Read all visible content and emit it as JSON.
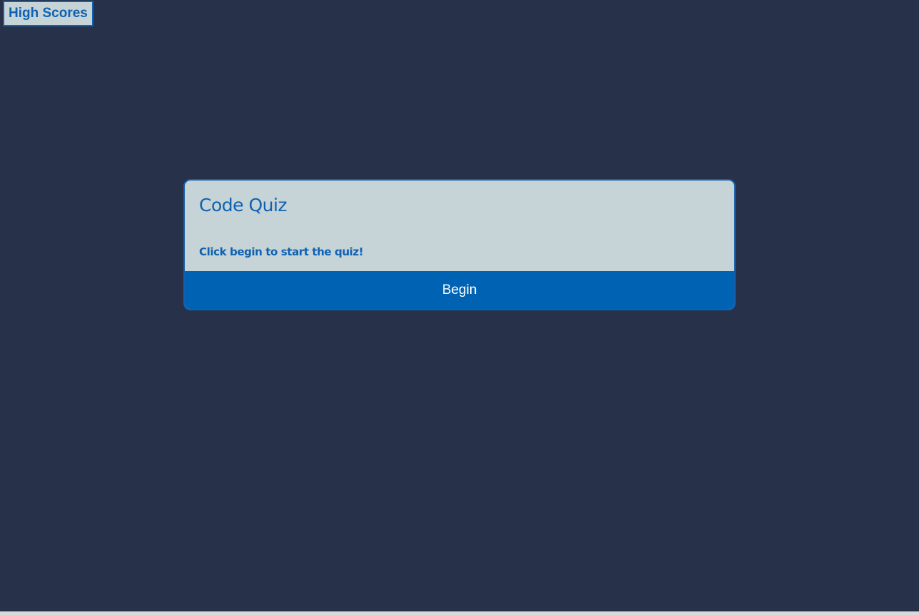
{
  "header": {
    "high_scores_label": "High Scores"
  },
  "quiz": {
    "title": "Code Quiz",
    "instructions": "Click begin to start the quiz!",
    "begin_label": "Begin"
  },
  "colors": {
    "background": "#27324a",
    "card": "#c6d3d7",
    "accent": "#0062b3",
    "text_accent": "#0f62b2"
  }
}
